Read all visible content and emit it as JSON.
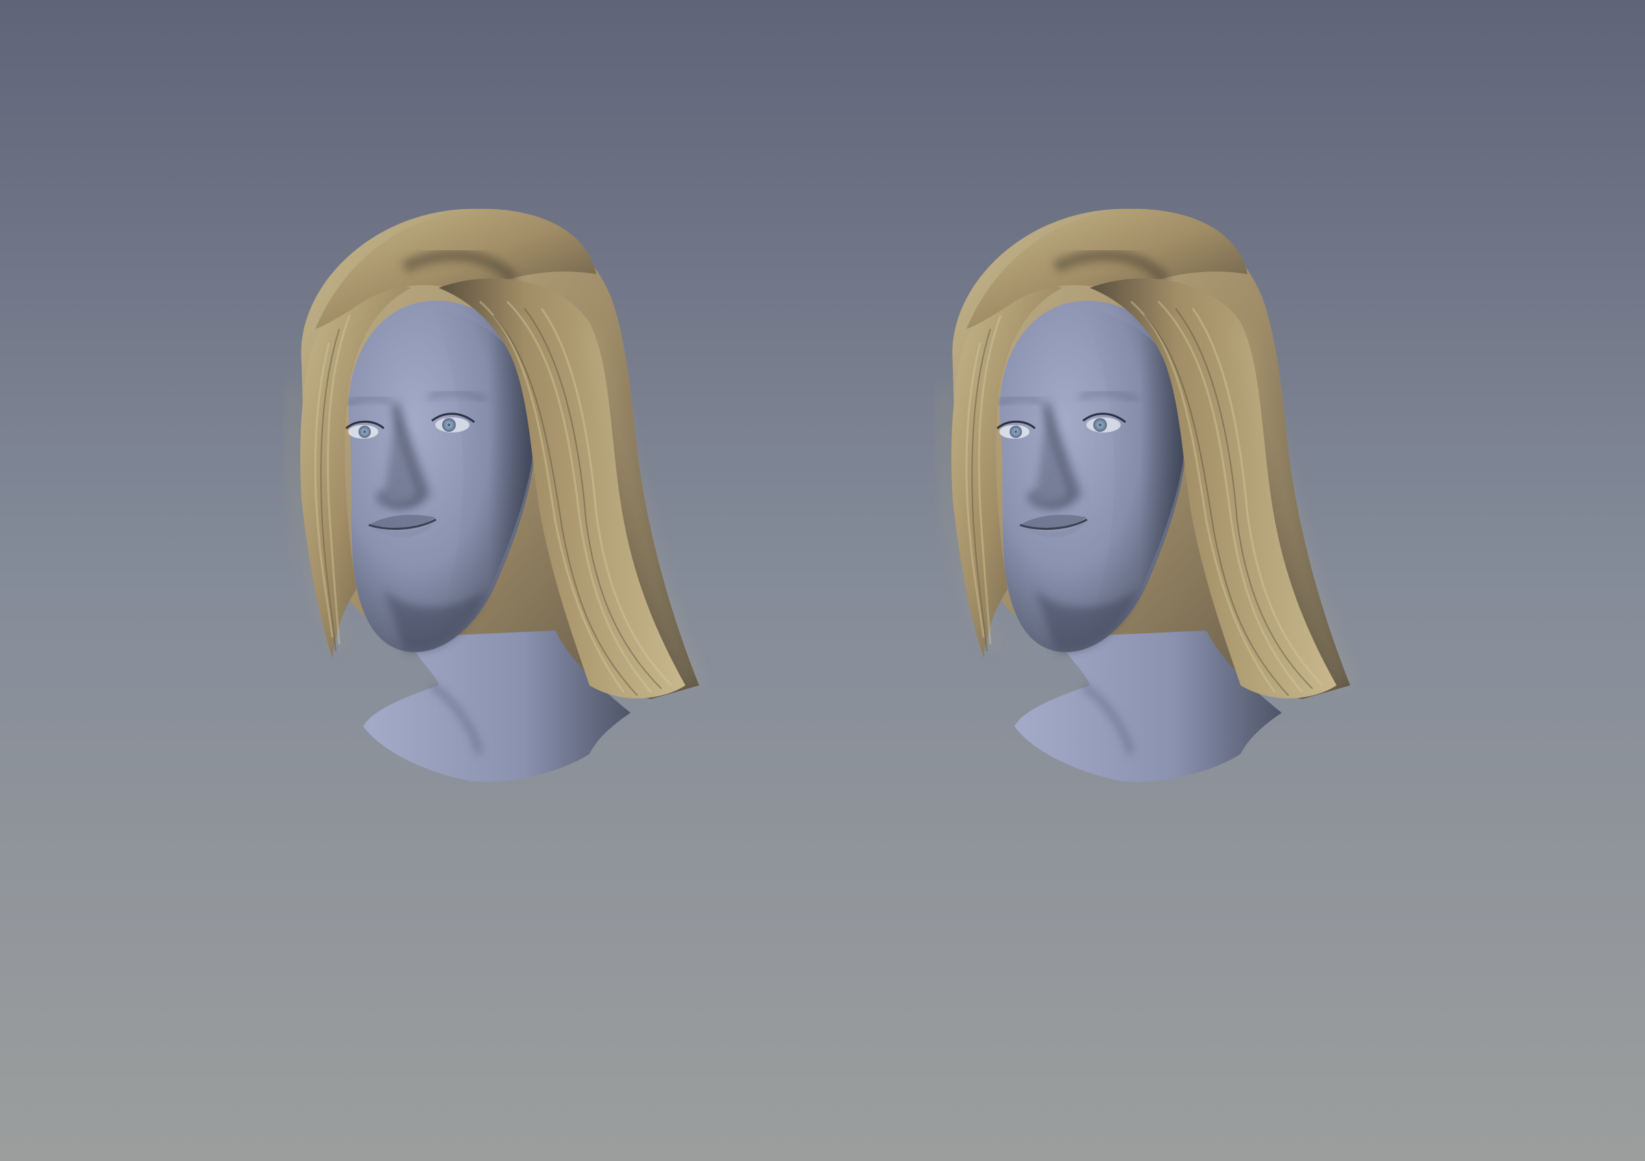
{
  "scene": {
    "background_top": "#5f6478",
    "background_mid": "#858c99",
    "background_bottom": "#9c9e9d",
    "skin_light": "#a3abc8",
    "skin_mid": "#8a92b0",
    "skin_shadow": "#4e5567",
    "hair_light": "#c8b88c",
    "hair_mid": "#a18d66",
    "hair_dark": "#5b5140",
    "eye_iris": "#8fa7c4"
  },
  "figures": [
    {
      "name": "head-render-left"
    },
    {
      "name": "head-render-right"
    }
  ]
}
